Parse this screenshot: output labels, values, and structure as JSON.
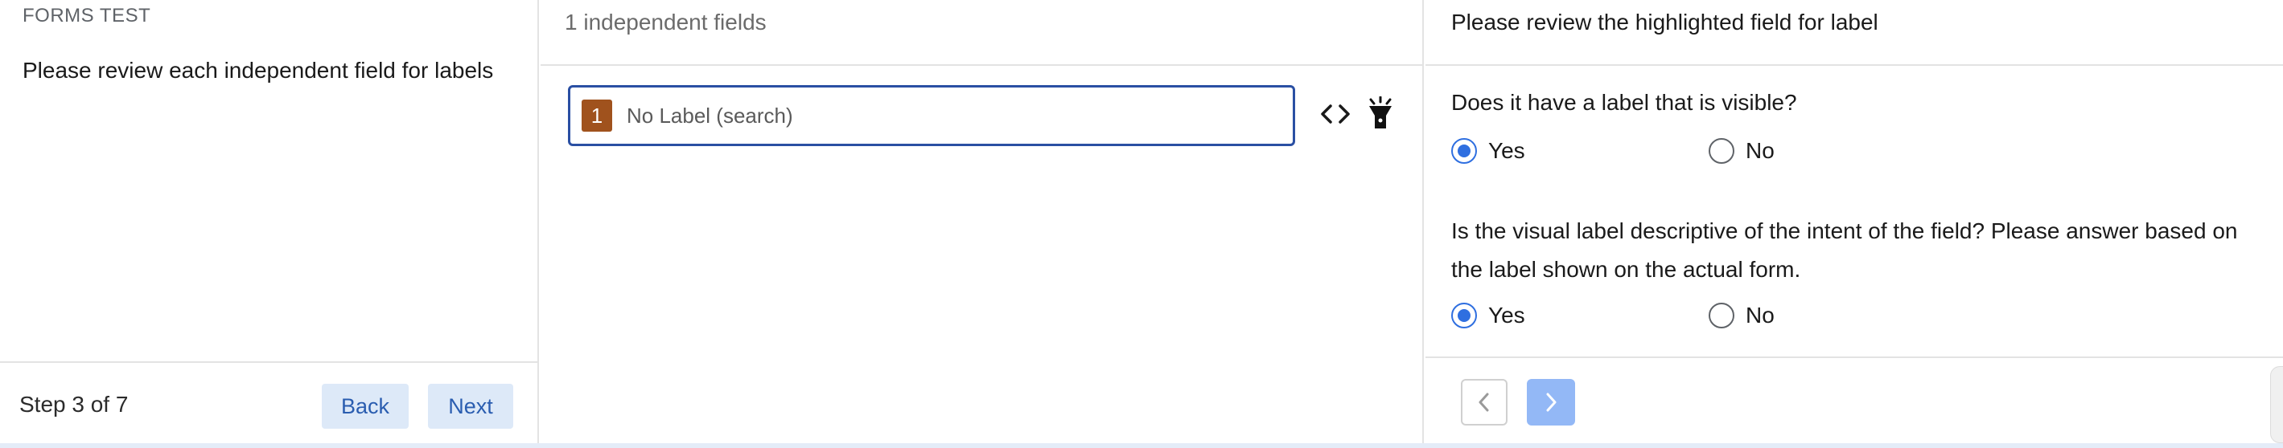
{
  "left": {
    "eyebrow": "FORMS TEST",
    "instructions": "Please review each independent field for labels",
    "step_text": "Step 3 of 7",
    "back_label": "Back",
    "next_label": "Next"
  },
  "middle": {
    "header": "1 independent fields",
    "fields": [
      {
        "number": "1",
        "label": "No Label (search)"
      }
    ],
    "icons": [
      "code-icon",
      "flashlight-icon"
    ]
  },
  "right": {
    "header": "Please review the highlighted field for label",
    "questions": [
      {
        "text": "Does it have a label that is visible?",
        "options": [
          "Yes",
          "No"
        ],
        "selected": "Yes"
      },
      {
        "text": "Is the visual label descriptive of the intent of the field? Please answer based on the label shown on the actual form.",
        "options": [
          "Yes",
          "No"
        ],
        "selected": "Yes"
      }
    ]
  },
  "colors": {
    "accent": "#2f6fe0",
    "field_border": "#2a4fa3",
    "badge": "#a0521d",
    "secondary_button_bg": "#dde9f8",
    "next_arrow_bg": "#93b8f6"
  }
}
